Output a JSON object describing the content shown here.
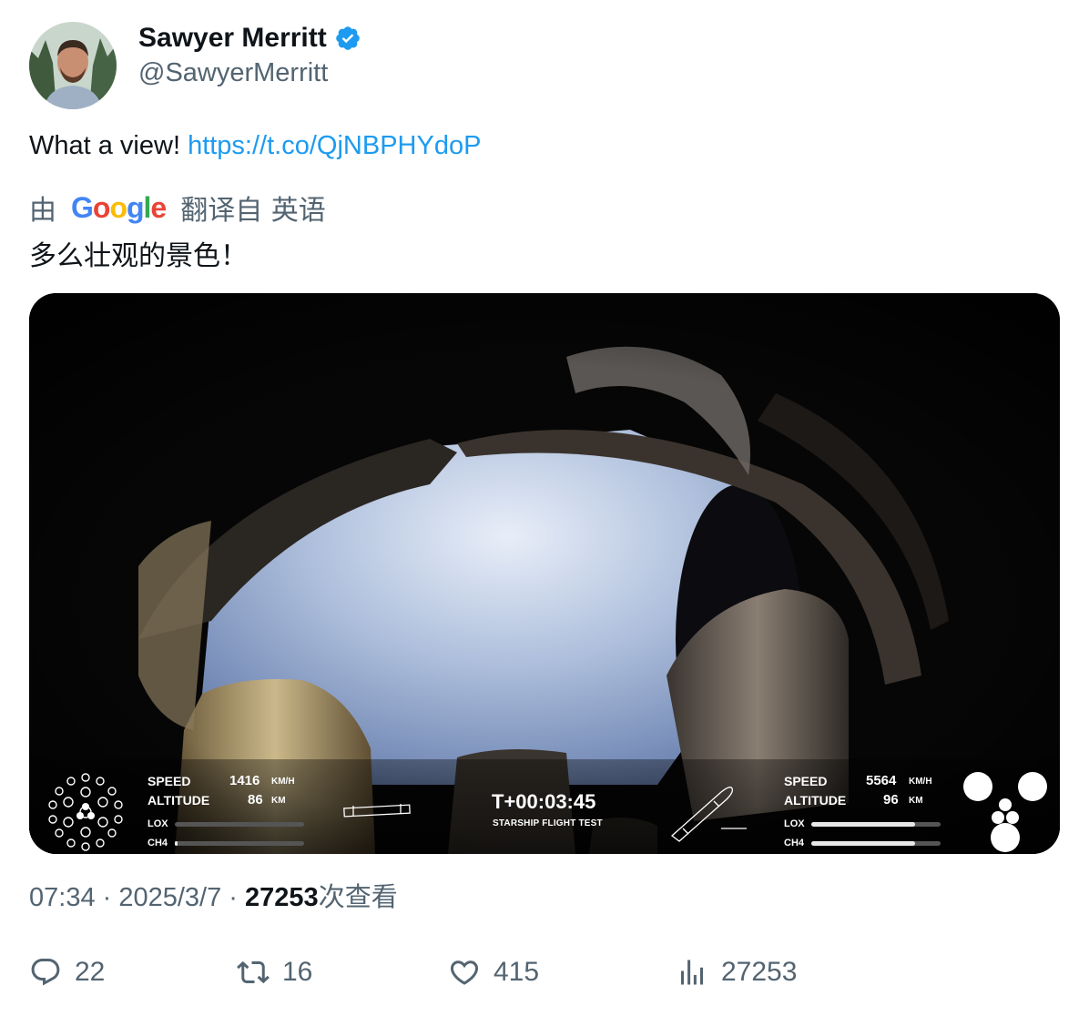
{
  "author": {
    "name": "Sawyer Merritt",
    "handle": "@SawyerMerritt",
    "verified": true,
    "avatar_icon": "avatar-photo"
  },
  "tweet": {
    "text": "What a view! ",
    "link": "https://t.co/QjNBPHYdoP"
  },
  "translation": {
    "prefix": "由",
    "provider": "Google",
    "suffix": "翻译自 英语",
    "text": "多么壮观的景色！"
  },
  "media": {
    "left_readout": {
      "speed_label": "SPEED",
      "speed_value": "1416",
      "speed_unit": "KM/H",
      "altitude_label": "ALTITUDE",
      "altitude_value": "86",
      "altitude_unit": "KM",
      "lox_label": "LOX",
      "ch4_label": "CH4",
      "lox_level": 0,
      "ch4_level": 0.02
    },
    "timer": "T+00:03:45",
    "timer_caption": "STARSHIP FLIGHT TEST",
    "right_readout": {
      "speed_label": "SPEED",
      "speed_value": "5564",
      "speed_unit": "KM/H",
      "altitude_label": "ALTITUDE",
      "altitude_value": "96",
      "altitude_unit": "KM",
      "lox_label": "LOX",
      "ch4_label": "CH4",
      "lox_level": 0.8,
      "ch4_level": 0.8
    }
  },
  "meta": {
    "time": "07:34",
    "separator": " · ",
    "date": "2025/3/7",
    "views": "27253",
    "views_suffix": "次查看"
  },
  "actions": {
    "replies": "22",
    "retweets": "16",
    "likes": "415",
    "views": "27253"
  },
  "colors": {
    "link": "#1d9bf0",
    "verified": "#1d9bf0",
    "secondary_text": "#536471"
  }
}
